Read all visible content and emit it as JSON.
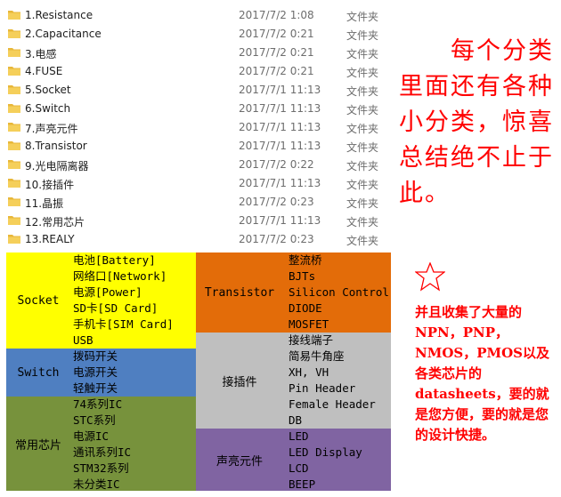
{
  "files": [
    {
      "name": "1.Resistance",
      "date": "2017/7/2 1:08",
      "type": "文件夹"
    },
    {
      "name": "2.Capacitance",
      "date": "2017/7/2 0:21",
      "type": "文件夹"
    },
    {
      "name": "3.电感",
      "date": "2017/7/2 0:21",
      "type": "文件夹"
    },
    {
      "name": "4.FUSE",
      "date": "2017/7/2 0:21",
      "type": "文件夹"
    },
    {
      "name": "5.Socket",
      "date": "2017/7/1 11:13",
      "type": "文件夹"
    },
    {
      "name": "6.Switch",
      "date": "2017/7/1 11:13",
      "type": "文件夹"
    },
    {
      "name": "7.声亮元件",
      "date": "2017/7/1 11:13",
      "type": "文件夹"
    },
    {
      "name": "8.Transistor",
      "date": "2017/7/1 11:13",
      "type": "文件夹"
    },
    {
      "name": "9.光电隔离器",
      "date": "2017/7/2 0:22",
      "type": "文件夹"
    },
    {
      "name": "10.接插件",
      "date": "2017/7/1 11:13",
      "type": "文件夹"
    },
    {
      "name": "11.晶振",
      "date": "2017/7/2 0:23",
      "type": "文件夹"
    },
    {
      "name": "12.常用芯片",
      "date": "2017/7/1 11:13",
      "type": "文件夹"
    },
    {
      "name": "13.REALY",
      "date": "2017/7/2 0:23",
      "type": "文件夹"
    }
  ],
  "note_top": [
    "每个分类",
    "里面还有各种",
    "小分类，惊喜",
    "总结绝不止于",
    "此。"
  ],
  "categories": {
    "socket": {
      "label": "Socket",
      "items": [
        "电池[Battery]",
        "网络口[Network]",
        "电源[Power]",
        "SD卡[SD Card]",
        "手机卡[SIM Card]",
        "USB"
      ]
    },
    "switch": {
      "label": "Switch",
      "items": [
        "拨码开关",
        "电源开关",
        "轻触开关"
      ]
    },
    "chips": {
      "label": "常用芯片",
      "items": [
        "74系列IC",
        "STC系列",
        "电源IC",
        "通讯系列IC",
        "STM32系列",
        "未分类IC"
      ]
    },
    "transistor": {
      "label": "Transistor",
      "items": [
        "整流桥",
        "BJTs",
        "Silicon Control",
        "DIODE",
        "MOSFET"
      ]
    },
    "connector": {
      "label": "接插件",
      "items": [
        "接线端子",
        "简易牛角座",
        "XH, VH",
        "Pin Header",
        "Female Header",
        "DB"
      ]
    },
    "audio": {
      "label": "声亮元件",
      "items": [
        "LED",
        "LED Display",
        "LCD",
        "BEEP"
      ]
    }
  },
  "note_bottom": "并且收集了大量的NPN，PNP，NMOS，PMOS以及各类芯片的datasheets，要的就是您方便，要的就是您的设计快捷。",
  "colors": {
    "note": "#ff0000",
    "socket": "#ffff00",
    "switch": "#4f7fc1",
    "chips": "#77923c",
    "transistor": "#e36c09",
    "connector": "#bfbfbf",
    "audio": "#8064a2"
  },
  "icons": {
    "folder": "folder-icon",
    "star": "star-icon"
  }
}
